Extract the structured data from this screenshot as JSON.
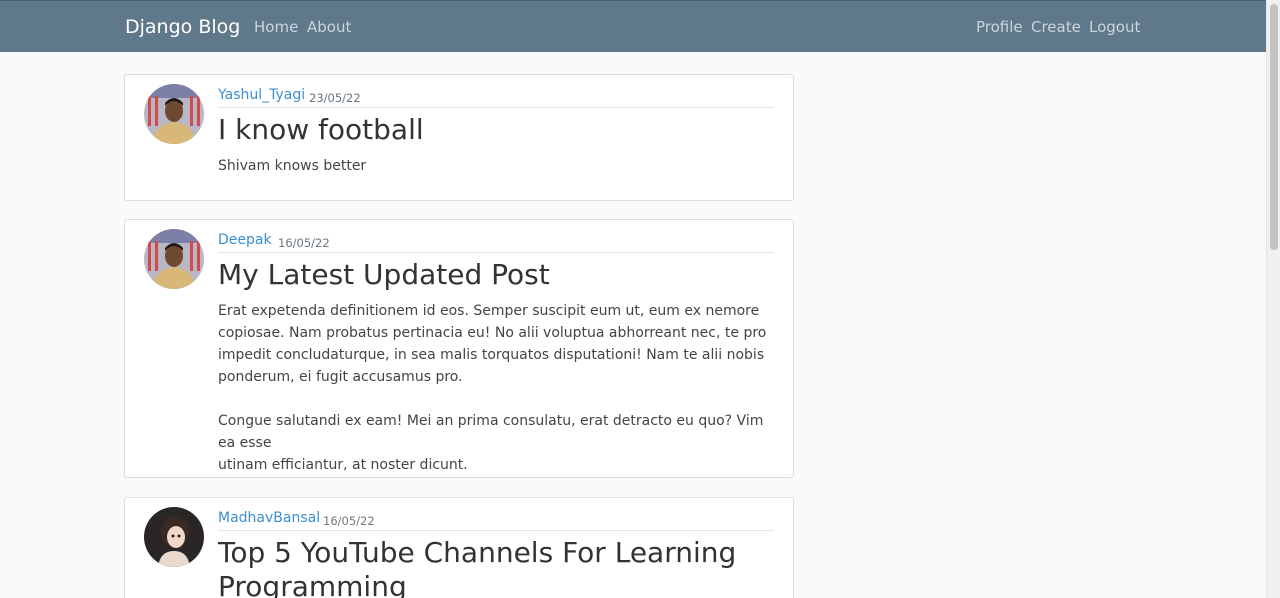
{
  "navbar": {
    "brand": "Django Blog",
    "left_links": [
      "Home",
      "About"
    ],
    "right_links": [
      "Profile",
      "Create",
      "Logout"
    ]
  },
  "posts": [
    {
      "author": "Yashul_Tyagi",
      "date": "23/05/22",
      "title": "I know football",
      "content": [
        "Shivam knows better"
      ]
    },
    {
      "author": "Deepak",
      "date": "16/05/22",
      "title": "My Latest Updated Post",
      "content": [
        "Erat expetenda definitionem id eos. Semper suscipit eum ut, eum ex nemore",
        "copiosae. Nam probatus pertinacia eu! No alii voluptua abhorreant nec, te pro",
        "impedit concludaturque, in sea malis torquatos disputationi! Nam te alii nobis",
        "ponderum, ei fugit accusamus pro.",
        "Congue salutandi ex eam! Mei an prima consulatu, erat detracto eu quo? Vim ea esse",
        "utinam efficiantur, at noster dicunt."
      ]
    },
    {
      "author": "MadhavBansal",
      "date": "16/05/22",
      "title": [
        "Top 5 YouTube Channels For Learning",
        "Programming"
      ],
      "content": []
    }
  ],
  "colors": {
    "navbar_bg": "#5f788a",
    "author_link": "#3a8fd0",
    "page_bg": "#fafafa"
  },
  "icons": [
    "profile-avatar-photo"
  ]
}
